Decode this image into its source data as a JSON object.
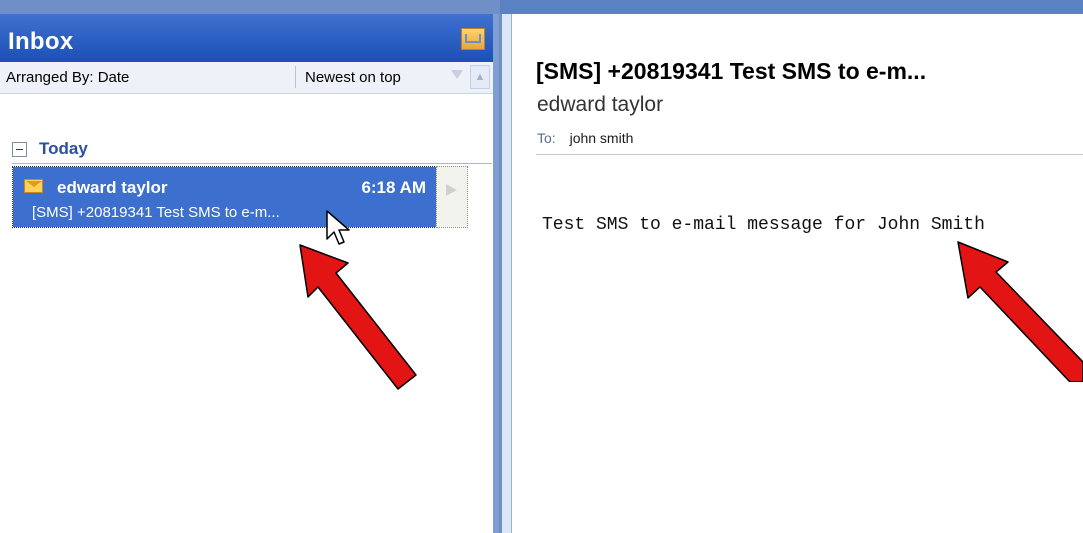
{
  "inbox": {
    "title": "Inbox",
    "arranged_by": "Arranged By: Date",
    "sort_order": "Newest on top",
    "group_label": "Today",
    "message": {
      "sender": "edward taylor",
      "time": "6:18 AM",
      "preview": "[SMS] +20819341  Test SMS to e-m..."
    }
  },
  "reading_pane": {
    "subject": "[SMS] +20819341  Test SMS to e-m...",
    "from": "edward taylor",
    "to_label": "To:",
    "to_value": "john smith",
    "body": "Test SMS to e-mail message for John Smith"
  },
  "icons": {
    "inbox_corner": "folder-mail-icon",
    "envelope": "envelope-icon",
    "flag": "flag-icon",
    "cursor": "mouse-cursor-icon",
    "collapse": "collapse-icon",
    "arrow": "red-arrow-icon"
  },
  "colors": {
    "header_blue": "#1c50b7",
    "selected_row": "#3d6fcf",
    "arrow_red": "#e21414"
  }
}
